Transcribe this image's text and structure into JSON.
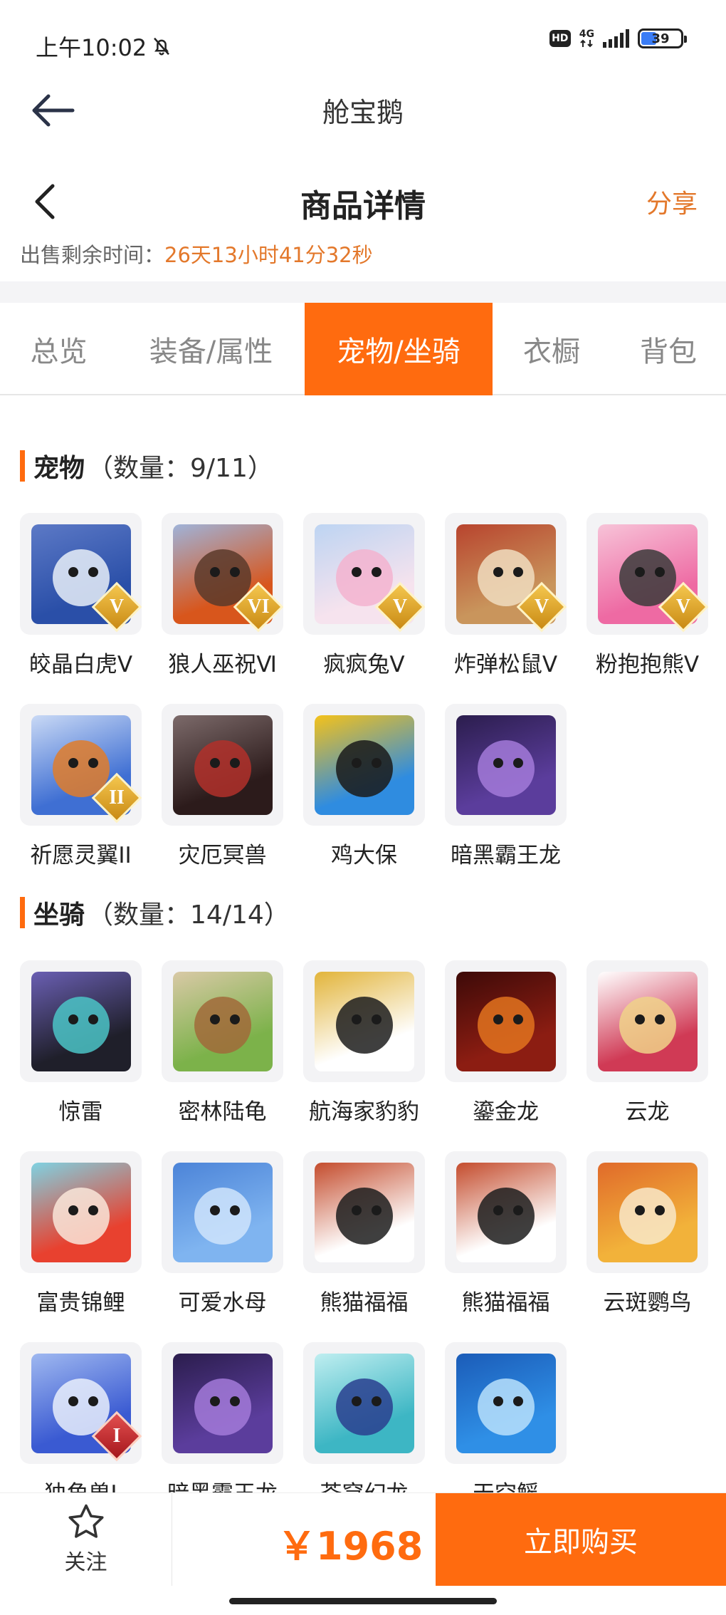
{
  "status_bar": {
    "time": "上午10:02",
    "hd_badge": "HD",
    "network": "4G",
    "battery": "39",
    "battery_level": 0.39
  },
  "app_header": {
    "title": "舱宝鹅",
    "back_icon": "arrow-left-icon"
  },
  "page_header": {
    "title": "商品详情",
    "share_label": "分享",
    "back_icon": "chevron-left-icon"
  },
  "countdown": {
    "label": "出售剩余时间：",
    "value": "26天13小时41分32秒"
  },
  "tabs": [
    {
      "label": "总览",
      "active": false
    },
    {
      "label": "装备/属性",
      "active": false
    },
    {
      "label": "宠物/坐骑",
      "active": true
    },
    {
      "label": "衣橱",
      "active": false
    },
    {
      "label": "背包",
      "active": false
    }
  ],
  "pets_section": {
    "title": "宠物",
    "count_label": "（数量：9/11）",
    "items": [
      {
        "name": "皎晶白虎Ⅴ",
        "rank": "V",
        "rank_style": "gold",
        "colors": [
          "#2a4fa8",
          "#e8eef8",
          "#5c79c6"
        ]
      },
      {
        "name": "狼人巫祝Ⅵ",
        "rank": "VI",
        "rank_style": "gold",
        "colors": [
          "#d8561c",
          "#5b3a2a",
          "#9fb3d9"
        ]
      },
      {
        "name": "疯疯兔Ⅴ",
        "rank": "V",
        "rank_style": "gold",
        "colors": [
          "#f6e3ee",
          "#f3b3cf",
          "#bdd4f2"
        ]
      },
      {
        "name": "炸弹松鼠Ⅴ",
        "rank": "V",
        "rank_style": "gold",
        "colors": [
          "#c9955c",
          "#f0ddc0",
          "#b8442e"
        ]
      },
      {
        "name": "粉抱抱熊Ⅴ",
        "rank": "V",
        "rank_style": "gold",
        "colors": [
          "#ee6aa3",
          "#3b3b3b",
          "#f7c3d8"
        ]
      },
      {
        "name": "祈愿灵翼II",
        "rank": "II",
        "rank_style": "gold",
        "colors": [
          "#3f6fd3",
          "#e07d2a",
          "#c9d9f5"
        ]
      },
      {
        "name": "灾厄冥兽",
        "rank": "",
        "rank_style": "",
        "colors": [
          "#2c1b1b",
          "#b2302a",
          "#7c6a6a"
        ]
      },
      {
        "name": "鸡大保",
        "rank": "",
        "rank_style": "",
        "colors": [
          "#2f8ce0",
          "#1a1a1a",
          "#f5c21a"
        ]
      },
      {
        "name": "暗黑霸王龙",
        "rank": "",
        "rank_style": "",
        "colors": [
          "#5b3d9c",
          "#a37ad9",
          "#2b1d4d"
        ]
      }
    ]
  },
  "mounts_section": {
    "title": "坐骑",
    "count_label": "（数量：14/14）",
    "items": [
      {
        "name": "惊雷",
        "rank": "",
        "rank_style": "",
        "colors": [
          "#1f1f2a",
          "#4bc4c7",
          "#6a5fb3"
        ]
      },
      {
        "name": "密林陆龟",
        "rank": "",
        "rank_style": "",
        "colors": [
          "#7cb24a",
          "#a16a3a",
          "#d9c9a6"
        ]
      },
      {
        "name": "航海家豹豹",
        "rank": "",
        "rank_style": "",
        "colors": [
          "#ffffff",
          "#1d1d1d",
          "#e2b43a"
        ]
      },
      {
        "name": "鎏金龙",
        "rank": "",
        "rank_style": "",
        "colors": [
          "#8c1d12",
          "#e2731f",
          "#3d0a08"
        ]
      },
      {
        "name": "云龙",
        "rank": "",
        "rank_style": "",
        "colors": [
          "#d03a55",
          "#f0d28a",
          "#ffffff"
        ]
      },
      {
        "name": "富贵锦鲤",
        "rank": "",
        "rank_style": "",
        "colors": [
          "#e8412f",
          "#f9e6d9",
          "#7fd2e2"
        ]
      },
      {
        "name": "可爱水母",
        "rank": "",
        "rank_style": "",
        "colors": [
          "#7fb4f0",
          "#cfe4fb",
          "#4c84d8"
        ]
      },
      {
        "name": "熊猫福福",
        "rank": "",
        "rank_style": "",
        "colors": [
          "#ffffff",
          "#1d1d1d",
          "#c44c2d"
        ]
      },
      {
        "name": "熊猫福福",
        "rank": "",
        "rank_style": "",
        "colors": [
          "#ffffff",
          "#1d1d1d",
          "#c44c2d"
        ]
      },
      {
        "name": "云斑鹦鸟",
        "rank": "",
        "rank_style": "",
        "colors": [
          "#f2b23a",
          "#f8e7c9",
          "#e06a2a"
        ]
      },
      {
        "name": "独角兽I",
        "rank": "I",
        "rank_style": "red",
        "colors": [
          "#3a5ad2",
          "#e9eefb",
          "#9fb8f0"
        ]
      },
      {
        "name": "暗黑霸王龙",
        "rank": "",
        "rank_style": "",
        "colors": [
          "#5b3d9c",
          "#a37ad9",
          "#2b1d4d"
        ]
      },
      {
        "name": "苍穹幻龙",
        "rank": "",
        "rank_style": "",
        "colors": [
          "#3db6c4",
          "#2a3f8f",
          "#bfeef0"
        ]
      },
      {
        "name": "天空鳐",
        "rank": "",
        "rank_style": "",
        "colors": [
          "#2f8fe6",
          "#b9e1fb",
          "#1b5cb8"
        ]
      }
    ]
  },
  "bottom_bar": {
    "follow_label": "关注",
    "follow_icon": "star-outline-icon",
    "price": "￥1968",
    "buy_label": "立即购买"
  },
  "colors": {
    "accent": "#ff6b0f",
    "accent_text": "#e3782b"
  }
}
